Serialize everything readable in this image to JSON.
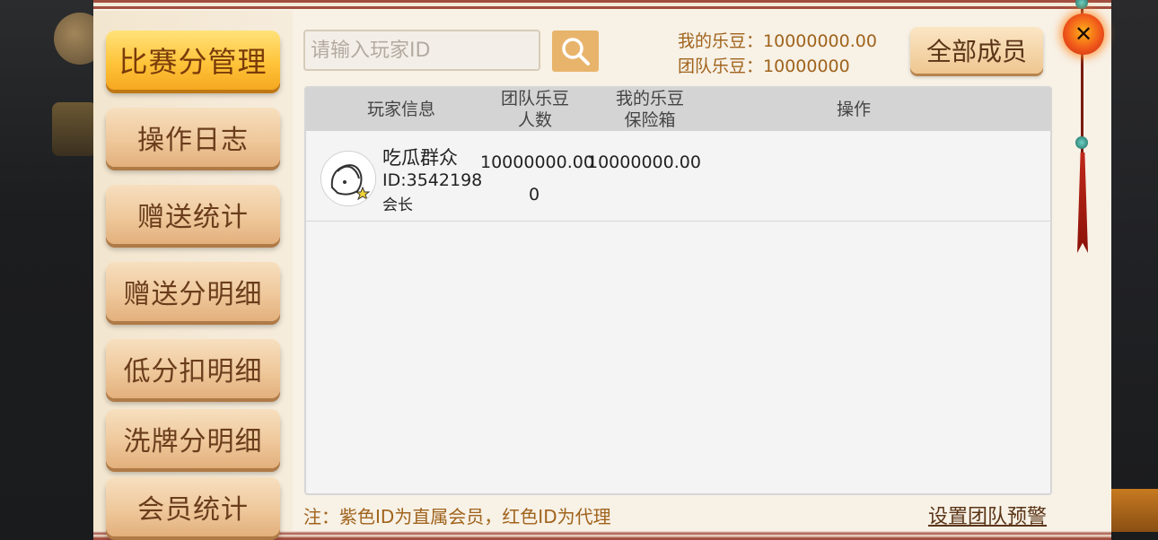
{
  "sidebar": {
    "items": [
      {
        "label": "比赛分管理",
        "active": true
      },
      {
        "label": "操作日志"
      },
      {
        "label": "赠送统计"
      },
      {
        "label": "赠送分明细"
      },
      {
        "label": "低分扣明细"
      },
      {
        "label": "洗牌分明细"
      },
      {
        "label": "会员统计"
      }
    ]
  },
  "search": {
    "placeholder": "请输入玩家ID",
    "value": ""
  },
  "beans": {
    "my_label": "我的乐豆：",
    "my_value": "10000000.00",
    "team_label": "团队乐豆：",
    "team_value": "10000000"
  },
  "all_members_button": "全部成员",
  "table": {
    "headers": {
      "player_info": "玩家信息",
      "team_beans_line1": "团队乐豆",
      "team_beans_line2": "人数",
      "my_beans_line1": "我的乐豆",
      "my_beans_line2": "保险箱",
      "action": "操作"
    },
    "rows": [
      {
        "name": "吃瓜群众",
        "id": "ID:3542198",
        "role": "会长",
        "team_beans": "10000000.00",
        "count": "0",
        "safe_box": "10000000.00"
      }
    ]
  },
  "footer": {
    "note": "注：紫色ID为直属会员，红色ID为代理",
    "link": "设置团队预警"
  },
  "colors": {
    "accent": "#ffc43a",
    "panel": "#f7f1e6",
    "brown_text": "#a0631c"
  },
  "icons": {
    "search": "search-icon",
    "close": "close-icon"
  }
}
